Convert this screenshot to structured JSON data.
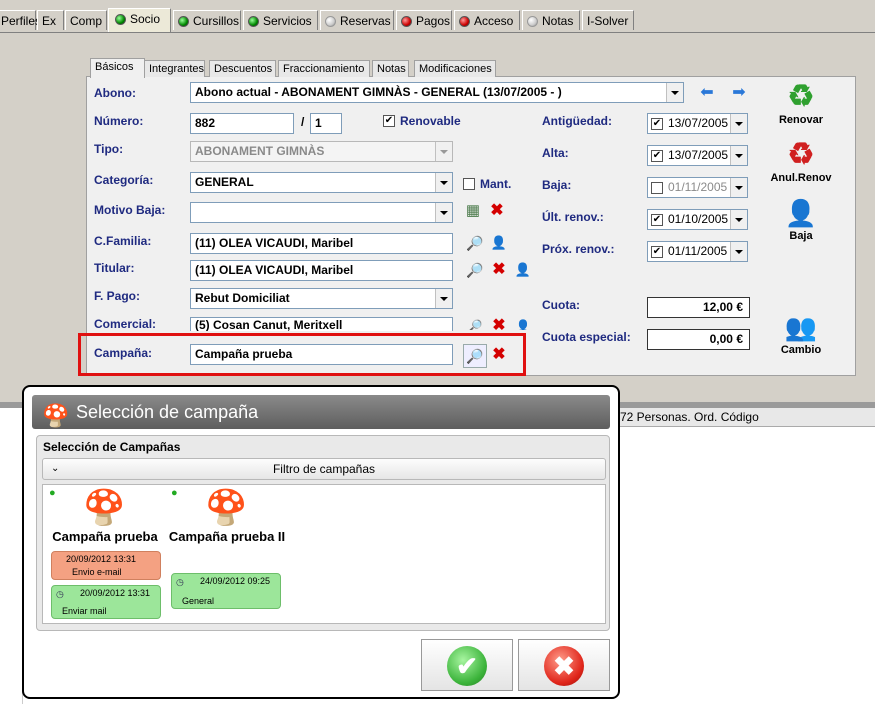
{
  "top_tabs": [
    {
      "label": "Perfiles",
      "led": "none",
      "active": false
    },
    {
      "label": "Ex",
      "led": "none",
      "active": false
    },
    {
      "label": "Comp",
      "led": "none",
      "active": false
    },
    {
      "label": "Socio",
      "led": "green",
      "active": true
    },
    {
      "label": "Cursillos",
      "led": "green",
      "active": false
    },
    {
      "label": "Servicios",
      "led": "green",
      "active": false
    },
    {
      "label": "Reservas",
      "led": "gray",
      "active": false
    },
    {
      "label": "Pagos",
      "led": "red",
      "active": false
    },
    {
      "label": "Acceso",
      "led": "red",
      "active": false
    },
    {
      "label": "Notas",
      "led": "gray",
      "active": false
    },
    {
      "label": "I-Solver",
      "led": "none",
      "active": false
    }
  ],
  "sub_tabs": [
    "Básicos",
    "Integrantes",
    "Descuentos",
    "Fraccionamiento",
    "Notas",
    "Modificaciones"
  ],
  "form": {
    "abono_label": "Abono:",
    "abono_value": "Abono actual - ABONAMENT GIMNÀS - GENERAL (13/07/2005 - )",
    "numero_label": "Número:",
    "numero_value": "882",
    "numero_sep": "/",
    "numero_suffix": "1",
    "renovable_label": "Renovable",
    "tipo_label": "Tipo:",
    "tipo_value": "ABONAMENT GIMNÀS",
    "categoria_label": "Categoría:",
    "categoria_value": "GENERAL",
    "mant_label": "Mant.",
    "motivo_label": "Motivo Baja:",
    "motivo_value": "",
    "cfamilia_label": "C.Familia:",
    "cfamilia_value": "(11) OLEA VICAUDI, Maribel",
    "titular_label": "Titular:",
    "titular_value": "(11) OLEA VICAUDI, Maribel",
    "fpago_label": "F. Pago:",
    "fpago_value": "Rebut Domiciliat",
    "comercial_label": "Comercial:",
    "comercial_value": "(5) Cosan Canut, Meritxell",
    "campana_label": "Campaña:",
    "campana_value": "Campaña prueba"
  },
  "dates": {
    "antiguedad_label": "Antigüedad:",
    "antiguedad_value": "13/07/2005",
    "alta_label": "Alta:",
    "alta_value": "13/07/2005",
    "baja_label": "Baja:",
    "baja_value": "01/11/2005",
    "ult_label": "Últ. renov.:",
    "ult_value": "01/10/2005",
    "prox_label": "Próx. renov.:",
    "prox_value": "01/11/2005"
  },
  "cuota": {
    "cuota_label": "Cuota:",
    "cuota_value": "12,00 €",
    "especial_label": "Cuota especial:",
    "especial_value": "0,00 €"
  },
  "side_buttons": {
    "renovar": "Renovar",
    "anul": "Anul.Renov",
    "baja": "Baja",
    "cambio": "Cambio"
  },
  "lower": {
    "header_text": "72 Personas. Ord. Código"
  },
  "dialog": {
    "title": "Selección de campaña",
    "group_label": "Selección de Campañas",
    "filter_label": "Filtro de campañas",
    "cards": [
      {
        "title": "Campaña prueba",
        "pills": [
          {
            "date": "20/09/2012 13:31",
            "status": "Envio e-mail",
            "color": "orange",
            "clock": false
          },
          {
            "date": "20/09/2012 13:31",
            "status": "Enviar mail",
            "color": "green",
            "clock": true
          }
        ]
      },
      {
        "title": "Campaña prueba II",
        "pills": [
          {
            "date": "24/09/2012 09:25",
            "status": "General",
            "color": "green",
            "clock": true
          }
        ]
      }
    ]
  },
  "colors": {
    "label_blue": "#1f2a80",
    "highlight_red": "#e01010",
    "pill_orange": "#f4a182",
    "pill_green": "#9ce69a"
  }
}
